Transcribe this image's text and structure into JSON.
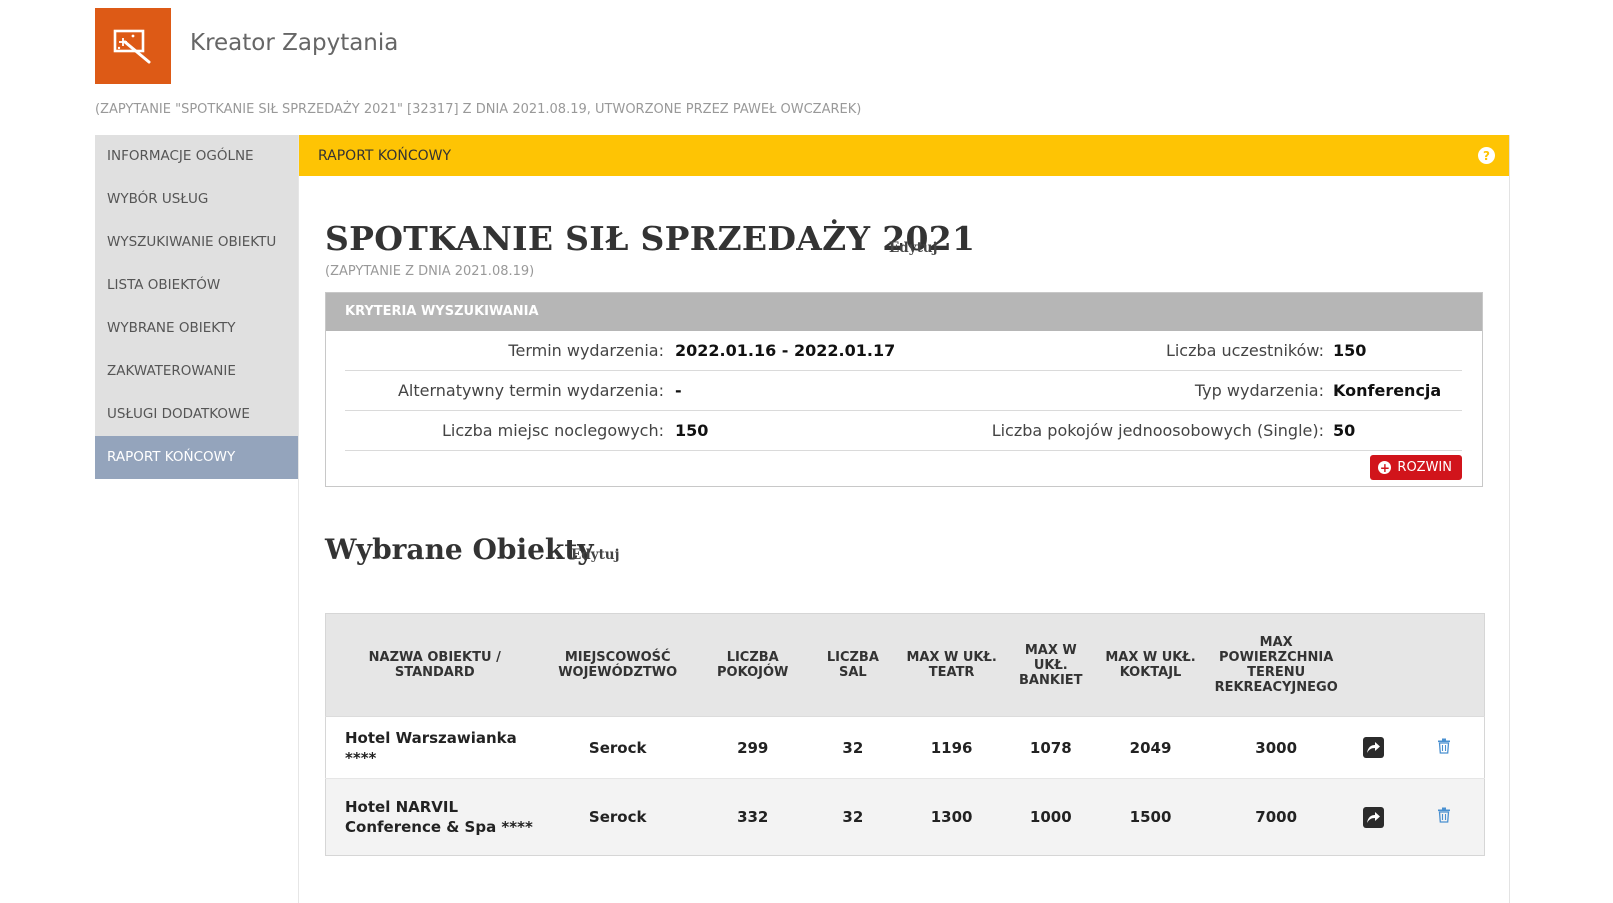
{
  "header": {
    "title": "Kreator Zapytania",
    "logo_icon": "wand-screen-icon",
    "subtitle": "(ZAPYTANIE \"SPOTKANIE SIŁ SPRZEDAŻY 2021\" [32317] Z DNIA 2021.08.19, UTWORZONE PRZEZ PAWEŁ OWCZAREK)"
  },
  "sidebar": {
    "items": [
      {
        "label": "INFORMACJE OGÓLNE"
      },
      {
        "label": "WYBÓR USŁUG"
      },
      {
        "label": "WYSZUKIWANIE OBIEKTU"
      },
      {
        "label": "LISTA OBIEKTÓW"
      },
      {
        "label": "WYBRANE OBIEKTY"
      },
      {
        "label": "ZAKWATEROWANIE"
      },
      {
        "label": "USŁUGI DODATKOWE"
      },
      {
        "label": "RAPORT KOŃCOWY"
      }
    ],
    "active_index": 7
  },
  "section_bar": {
    "title": "RAPORT KOŃCOWY",
    "help": "?"
  },
  "event": {
    "title": "SPOTKANIE SIŁ SPRZEDAŻY 2021",
    "edit_label": "Edytuj",
    "subtitle": "(ZAPYTANIE Z DNIA 2021.08.19)"
  },
  "criteria": {
    "header": "KRYTERIA WYSZUKIWANIA",
    "rows": [
      {
        "label1": "Termin wydarzenia:",
        "value1": "2022.01.16 - 2022.01.17",
        "label2": "Liczba uczestników:",
        "value2": "150"
      },
      {
        "label1": "Alternatywny termin wydarzenia:",
        "value1": "-",
        "label2": "Typ wydarzenia:",
        "value2": "Konferencja"
      },
      {
        "label1": "Liczba miejsc noclegowych:",
        "value1": "150",
        "label2": "Liczba pokojów jednoosobowych (Single):",
        "value2": "50"
      }
    ],
    "expand_label": "ROZWIN"
  },
  "objects": {
    "title": "Wybrane Obiekty",
    "edit_label": "Edytuj",
    "columns": [
      "NAZWA OBIEKTU / STANDARD",
      "MIEJSCOWOŚĆ WOJEWÓDZTWO",
      "LICZBA POKOJÓW",
      "LICZBA SAL",
      "MAX W UKŁ. TEATR",
      "MAX W UKŁ. BANKIET",
      "MAX W UKŁ. KOKTAJL",
      "MAX POWIERZCHNIA TERENU REKREACYJNEGO"
    ],
    "rows": [
      {
        "name": "Hotel Warszawianka ****",
        "city": "Serock",
        "rooms": "299",
        "halls": "32",
        "theatre": "1196",
        "banquet": "1078",
        "cocktail": "2049",
        "area": "3000"
      },
      {
        "name": "Hotel NARVIL Conference & Spa ****",
        "city": "Serock",
        "rooms": "332",
        "halls": "32",
        "theatre": "1300",
        "banquet": "1000",
        "cocktail": "1500",
        "area": "7000"
      }
    ]
  },
  "colors": {
    "brand_orange": "#dd5a16",
    "section_yellow": "#fec404",
    "active_nav": "#94a4bc",
    "expand_red": "#d1141b",
    "trash_blue": "#4a90d0"
  }
}
